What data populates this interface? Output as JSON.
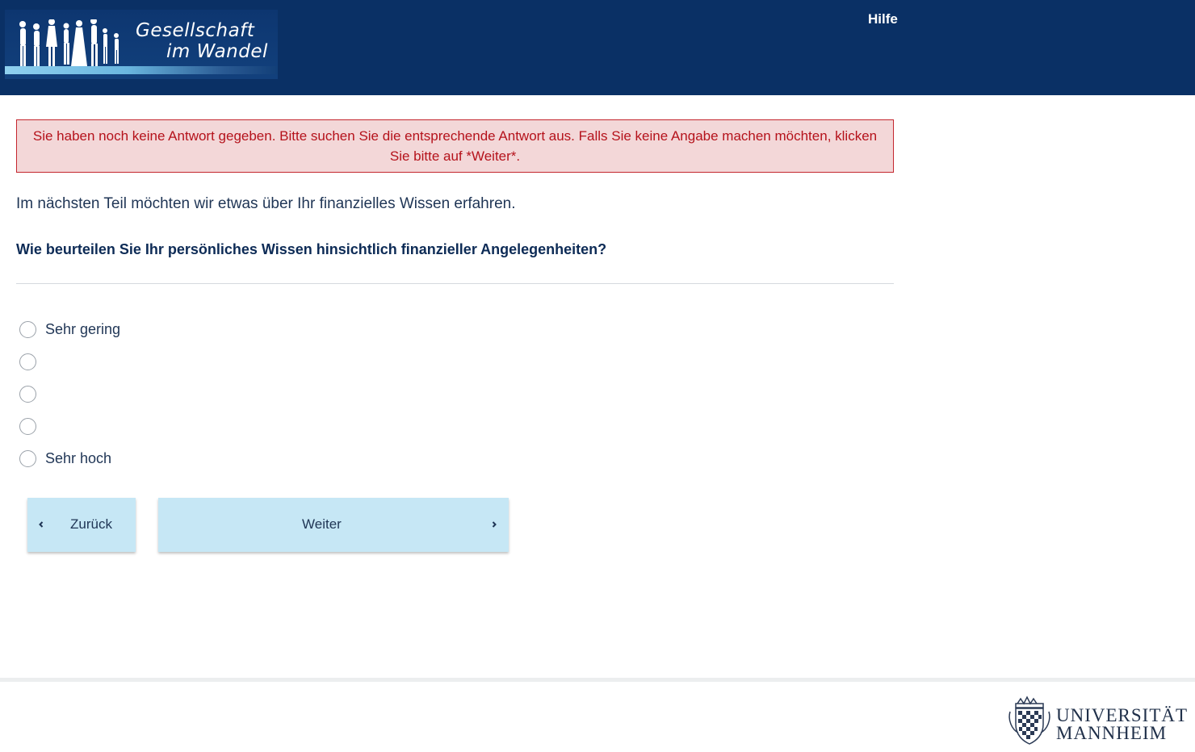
{
  "header": {
    "logo_line1": "Gesellschaft",
    "logo_line2": "im Wandel",
    "help_label": "Hilfe"
  },
  "alert": {
    "text": "Sie haben noch keine Antwort gegeben. Bitte suchen Sie die entsprechende Antwort aus. Falls Sie keine Angabe machen möchten, klicken Sie bitte auf *Weiter*."
  },
  "main": {
    "intro": "Im nächsten Teil möchten wir etwas über Ihr finanzielles Wissen erfahren.",
    "question": "Wie beurteilen Sie Ihr persönliches Wissen hinsichtlich finanzieller Angelegenheiten?",
    "options": [
      {
        "label": "Sehr gering"
      },
      {
        "label": ""
      },
      {
        "label": ""
      },
      {
        "label": ""
      },
      {
        "label": "Sehr hoch"
      }
    ]
  },
  "nav": {
    "back_label": "Zurück",
    "next_label": "Weiter"
  },
  "footer": {
    "university_line1": "UNIVERSITÄT",
    "university_line2": "MANNHEIM"
  },
  "colors": {
    "header_bg": "#0a3065",
    "alert_bg": "#f3d7d8",
    "alert_text": "#b5121b",
    "button_bg": "#c6e7f5"
  }
}
